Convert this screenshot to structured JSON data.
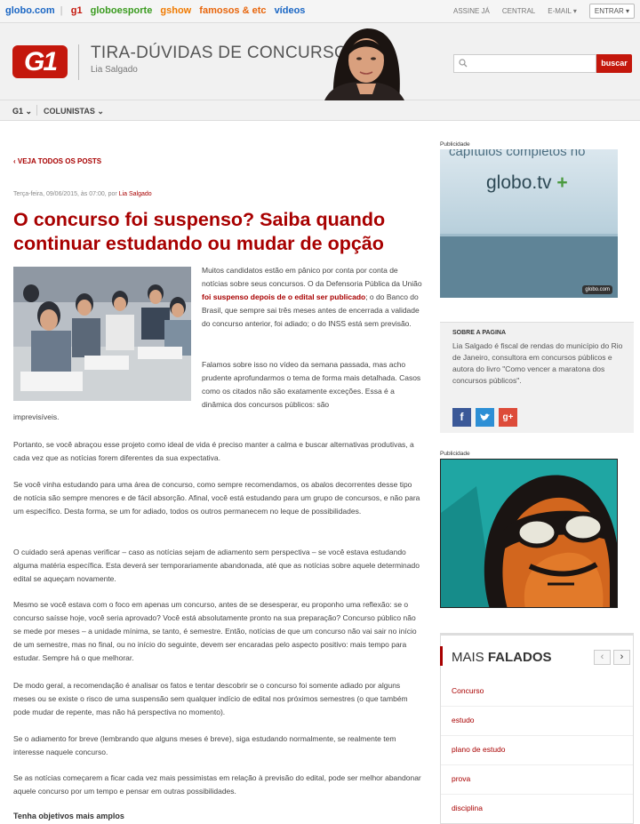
{
  "topbar": {
    "brands": [
      {
        "label": "globo.com",
        "color": "#1a66c4"
      },
      {
        "label": "g1",
        "color": "#c4170c"
      },
      {
        "label": "globoesporte",
        "color": "#3a9b1f"
      },
      {
        "label": "gshow",
        "color": "#f07a00"
      },
      {
        "label": "famosos & etc",
        "color": "#e8650b"
      },
      {
        "label": "vídeos",
        "color": "#1a66c4"
      }
    ],
    "assine": "ASSINE JÁ",
    "central": "CENTRAL",
    "email": "E-MAIL",
    "entrar": "ENTRAR"
  },
  "header": {
    "logo": "G1",
    "blog_title": "TIRA-DÚVIDAS DE CONCURSOS",
    "author": "Lia Salgado",
    "search_button": "buscar",
    "search_placeholder": ""
  },
  "nav": {
    "g1": "G1",
    "colunistas": "COLUNISTAS"
  },
  "post": {
    "back_link": "‹ VEJA TODOS OS POSTS",
    "meta_prefix": "Terça-feira, 09/06/2015, às 07:00, por ",
    "meta_author": "Lia Salgado",
    "title": "O concurso foi suspenso? Saiba quando continuar estudando ou mudar de opção",
    "p1a": "Muitos candidatos estão em pânico por conta por conta de notícias sobre seus concursos. O da Defensoria Pública da União ",
    "p1link": "foi suspenso depois de o edital ser publicado",
    "p1b": "; o do Banco do Brasil, que sempre sai três meses antes de encerrada a validade do concurso anterior, foi adiado; o do INSS está sem previsão.",
    "p2": "Falamos sobre isso no vídeo da semana passada, mas acho prudente aprofundarmos o tema de forma mais detalhada. Casos como os citados não são exatamente exceções. Essa é a dinâmica dos concursos públicos: são",
    "p2b": "imprevisíveis.",
    "p3": "Portanto, se você abraçou esse projeto como ideal de vida é preciso manter a calma e buscar alternativas produtivas, a cada vez que as notícias forem diferentes da sua expectativa.",
    "p4": "Se você vinha estudando para uma área de concurso, como sempre recomendamos, os abalos decorrentes desse tipo de notícia são sempre menores e de fácil absorção. Afinal, você está estudando para um grupo de concursos, e não para um específico. Desta forma, se um for adiado, todos os outros permanecem no leque de possibilidades.",
    "p5": "O cuidado será apenas verificar – caso as notícias sejam de adiamento sem perspectiva – se você estava estudando alguma matéria específica. Esta deverá ser temporariamente abandonada, até que as notícias sobre aquele determinado edital se aqueçam novamente.",
    "p6": "Mesmo se você estava com o foco em apenas um concurso, antes de se desesperar, eu proponho uma reflexão: se o concurso saísse hoje, você seria aprovado? Você está absolutamente pronto na sua preparação? Concurso público não se mede por meses – a unidade mínima, se tanto, é semestre. Então, notícias de que um concurso não vai sair no início de um semestre, mas no final, ou no início do seguinte, devem ser encaradas pelo aspecto positivo: mais tempo para estudar. Sempre há o que melhorar.",
    "p7": "De modo geral, a recomendação é analisar os fatos e tentar descobrir se o concurso foi somente adiado por alguns meses ou se existe o risco de uma suspensão sem qualquer indício de edital nos próximos semestres (o que também pode mudar de repente, mas não há perspectiva no momento).",
    "p8": "Se o adiamento for breve (lembrando que alguns meses é breve), siga estudando normalmente, se realmente tem interesse naquele concurso.",
    "p9": "Se as notícias começarem a ficar cada vez mais pessimistas em relação à previsão do edital, pode ser melhor abandonar aquele concurso por um tempo e pensar em outras possibilidades.",
    "subheading": "Tenha objetivos mais amplos"
  },
  "sidebar": {
    "pub1": "Publicidade",
    "ad1_title": "capítulos completos no",
    "ad1_logo": "globo.tv",
    "ad1_plus": "+",
    "ad1_mini": "globo.com",
    "about_head": "SOBRE A PAGINA",
    "about_text": "Lia Salgado é fiscal de rendas do município do Rio de Janeiro, consultora em concursos públicos e autora do livro \"Como vencer a maratona dos concursos públicos\".",
    "pub2": "Publicidade",
    "mais_light": "MAIS ",
    "mais_bold": "FALADOS",
    "tags": [
      "Concurso",
      "estudo",
      "plano de estudo",
      "prova",
      "disciplina"
    ]
  },
  "colors": {
    "accent": "#a80000",
    "g1red": "#c4170c",
    "facebook": "#3b5998",
    "twitter": "#2d8fd5",
    "gplus": "#dd4b39"
  }
}
